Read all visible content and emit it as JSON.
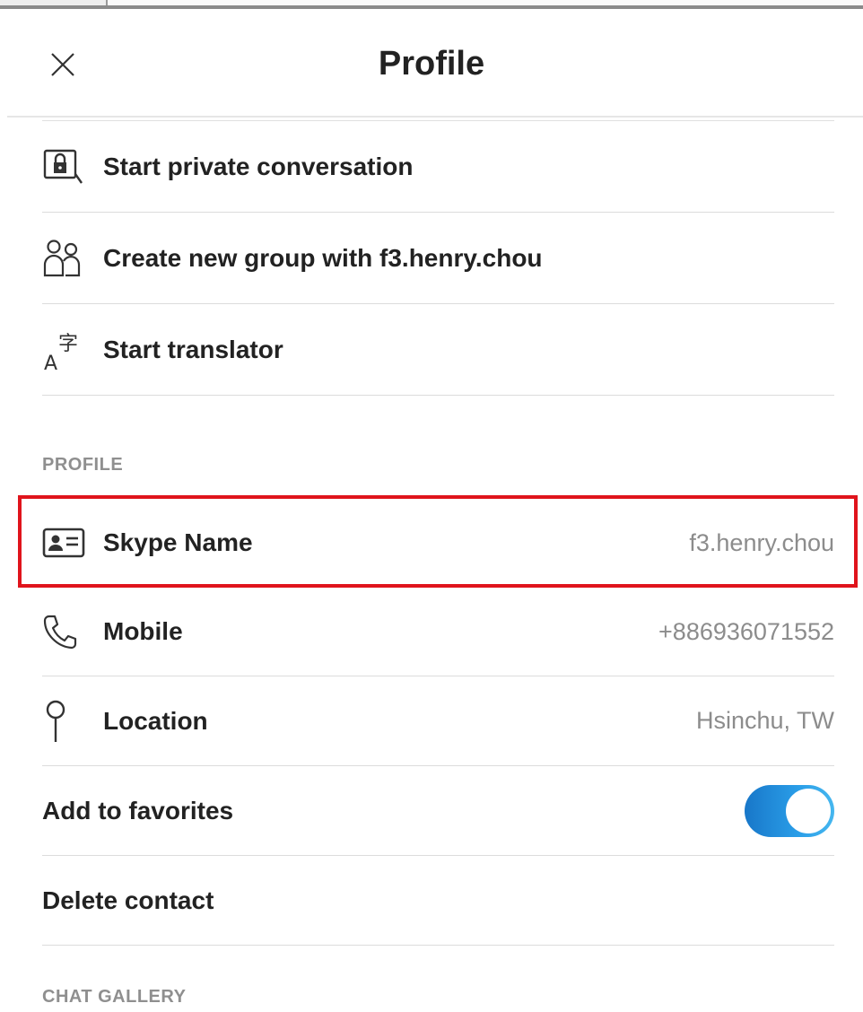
{
  "header": {
    "title": "Profile",
    "ghost_text": "f3.henry.chou"
  },
  "actions": [
    {
      "label": "Start private conversation",
      "icon": "private-conversation-icon"
    },
    {
      "label": "Create new group with f3.henry.chou",
      "icon": "group-icon"
    },
    {
      "label": "Start translator",
      "icon": "translator-icon"
    }
  ],
  "profile": {
    "section_label": "PROFILE",
    "skype_name": {
      "label": "Skype Name",
      "value": "f3.henry.chou",
      "icon": "contact-card-icon"
    },
    "mobile": {
      "label": "Mobile",
      "value": "+886936071552",
      "icon": "phone-icon"
    },
    "location": {
      "label": "Location",
      "value": "Hsinchu, TW",
      "icon": "location-pin-icon"
    }
  },
  "favorites": {
    "label": "Add to favorites",
    "enabled": true
  },
  "delete": {
    "label": "Delete contact"
  },
  "chat_gallery": {
    "section_label": "CHAT GALLERY"
  },
  "colors": {
    "highlight": "#e0141c",
    "toggle_start": "#1877c9",
    "toggle_end": "#46b7ef"
  }
}
